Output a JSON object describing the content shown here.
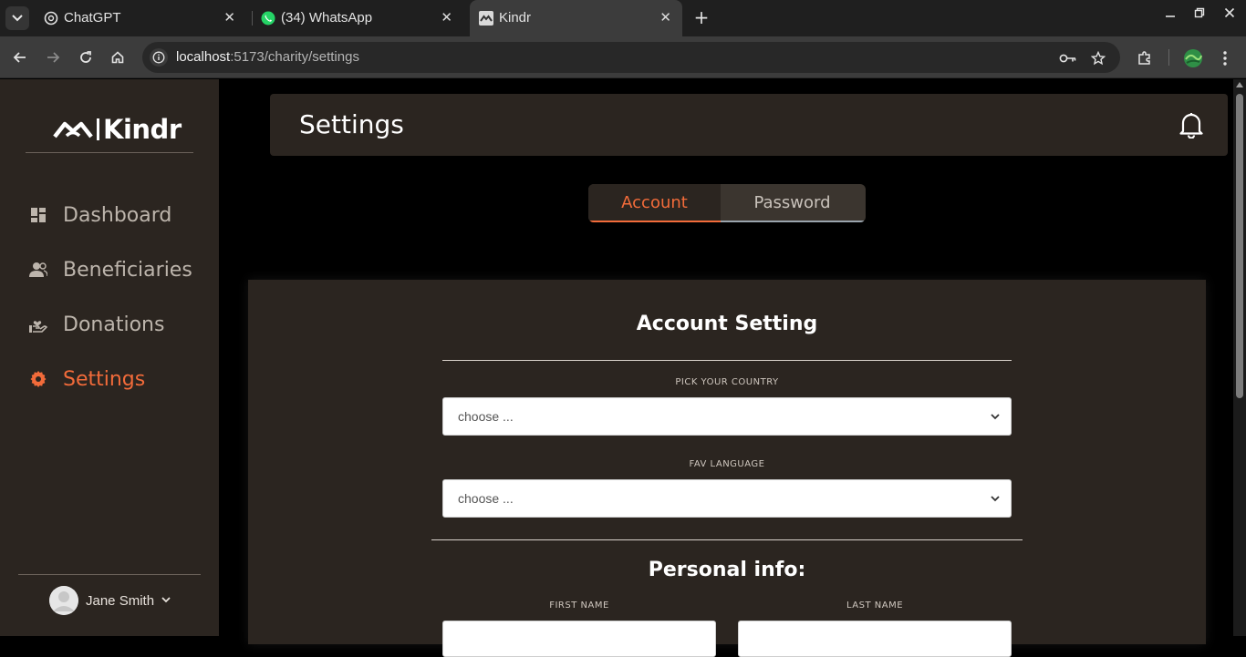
{
  "browser": {
    "tabs": [
      {
        "title": "ChatGPT",
        "icon": "chatgpt-icon"
      },
      {
        "title": "(34) WhatsApp",
        "icon": "whatsapp-icon"
      },
      {
        "title": "Kindr",
        "icon": "kindr-icon",
        "active": true
      }
    ],
    "url_host": "localhost",
    "url_path": ":5173/charity/settings"
  },
  "sidebar": {
    "logo_text": "Kindr",
    "items": [
      {
        "label": "Dashboard",
        "icon": "dashboard-icon"
      },
      {
        "label": "Beneficiaries",
        "icon": "beneficiaries-icon"
      },
      {
        "label": "Donations",
        "icon": "donations-icon"
      },
      {
        "label": "Settings",
        "icon": "settings-gear-icon",
        "active": true
      }
    ],
    "user_name": "Jane Smith"
  },
  "header": {
    "title": "Settings"
  },
  "settings_tabs": {
    "account": "Account",
    "password": "Password",
    "active": "Account"
  },
  "account_card": {
    "title": "Account Setting",
    "country_label": "PICK YOUR COUNTRY",
    "country_value": "choose ...",
    "language_label": "FAV LANGUAGE",
    "language_value": "choose ...",
    "personal_title": "Personal info:",
    "first_name_label": "FIRST NAME",
    "last_name_label": "LAST NAME"
  },
  "colors": {
    "accent": "#f26b3a",
    "sidebar_bg": "#2b2520",
    "page_bg": "#000000"
  }
}
